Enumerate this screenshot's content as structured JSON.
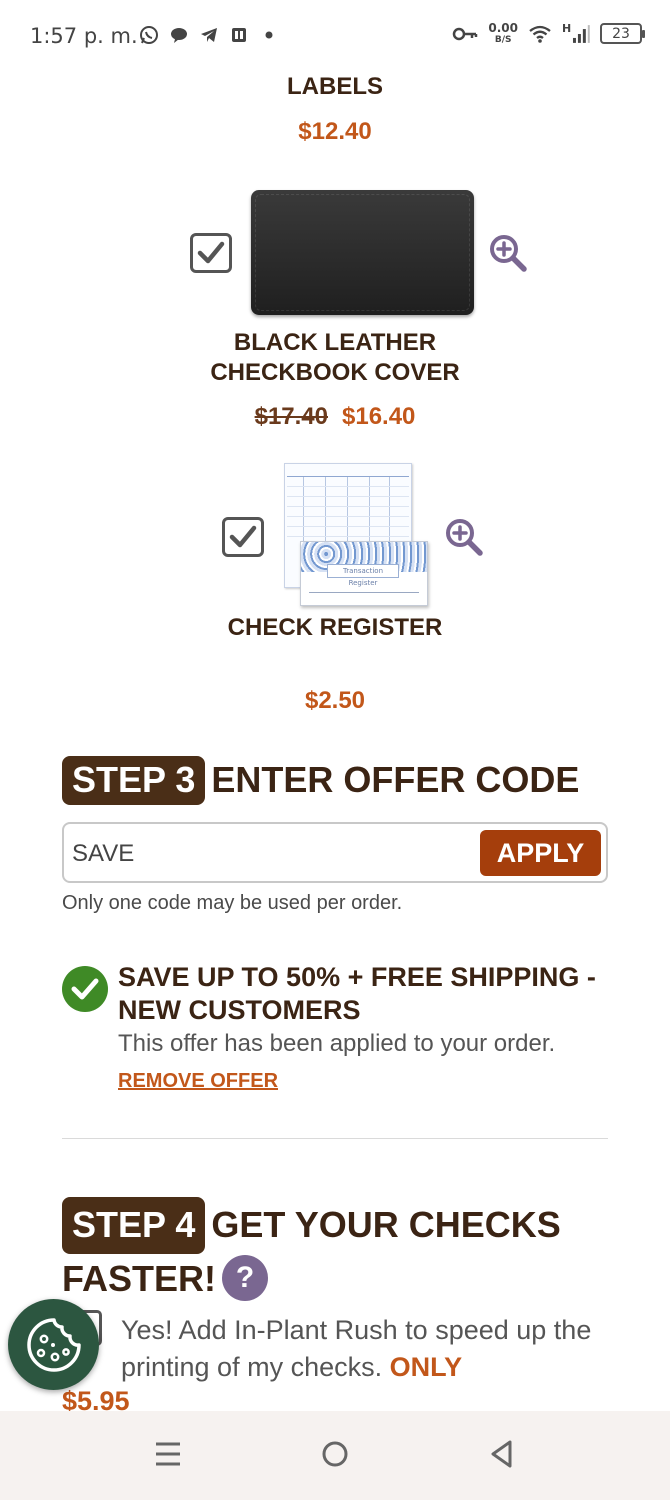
{
  "status_bar": {
    "time": "1:57 p. m.",
    "net_speed_value": "0.00",
    "net_speed_unit": "B/S",
    "network_label": "H",
    "battery": "23"
  },
  "labels_item": {
    "title": "LABELS",
    "price": "$12.40"
  },
  "leather_item": {
    "title_line1": "BLACK LEATHER",
    "title_line2": "CHECKBOOK COVER",
    "old_price": "$17.40",
    "price": "$16.40",
    "checked": true
  },
  "register_item": {
    "title": "CHECK REGISTER",
    "price": "$2.50",
    "image_text": "Transaction Register",
    "checked": true
  },
  "step3": {
    "badge": "STEP 3",
    "title": "ENTER OFFER CODE",
    "input_value": "SAVE",
    "apply_label": "APPLY",
    "note": "Only one code may be used per order."
  },
  "offer": {
    "title": "SAVE UP TO 50% + FREE SHIPPING - NEW CUSTOMERS",
    "description": "This offer has been applied to your order.",
    "remove_label": "REMOVE OFFER"
  },
  "step4": {
    "badge": "STEP 4",
    "title_line1": "GET YOUR CHECKS",
    "title_line2": "FASTER!",
    "help_glyph": "?",
    "rush_text": "Yes! Add In-Plant Rush to speed up the printing of my checks.",
    "rush_only": "ONLY",
    "rush_price": "$5.95"
  },
  "colors": {
    "brown": "#3b2414",
    "orange": "#c2571a",
    "apply": "#a53e0c",
    "success": "#3f8a26",
    "cookie": "#2c5640",
    "help": "#7a6791"
  }
}
